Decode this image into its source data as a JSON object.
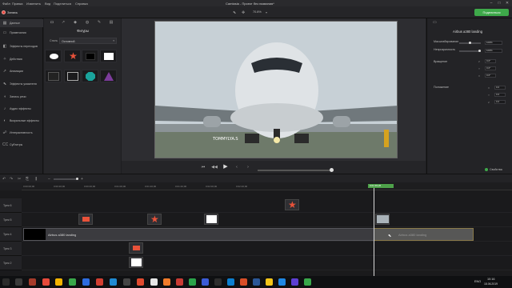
{
  "window": {
    "title": "Camtasia - Проект без названия*"
  },
  "menu": [
    "Файл",
    "Правка",
    "Изменить",
    "Вид",
    "Поделиться",
    "Справка"
  ],
  "toolbar": {
    "record_label": "Запись",
    "share_label": "Поделиться",
    "zoom": "70.8%"
  },
  "tools": [
    {
      "label": "Данные",
      "icon": "media-icon",
      "selected": true
    },
    {
      "label": "Примечания",
      "icon": "annotation-icon"
    },
    {
      "label": "Эффекты переходов",
      "icon": "transition-icon"
    },
    {
      "label": "Действия",
      "icon": "behavior-icon"
    },
    {
      "label": "Анимации",
      "icon": "animation-icon"
    },
    {
      "label": "Эффекты указателя",
      "icon": "cursor-effects-icon"
    },
    {
      "label": "Запись речи",
      "icon": "voice-narration-icon"
    },
    {
      "label": "Аудио эффекты",
      "icon": "audio-effects-icon"
    },
    {
      "label": "Визуальные эффекты",
      "icon": "visual-effects-icon"
    },
    {
      "label": "Интерактивность",
      "icon": "interactivity-icon"
    },
    {
      "label": "Субтитры",
      "icon": "captions-icon"
    }
  ],
  "assets": {
    "title": "Фигуры",
    "style_label": "Стиль",
    "style_value": "Основной",
    "tab_icons": [
      "callout-icon",
      "arrow-icon",
      "shape-icon",
      "blur-icon",
      "sketch-icon",
      "keystroke-icon"
    ],
    "shapes": [
      "ellipse-shape-icon",
      "star-shape-icon",
      "black-rect-shape-icon",
      "white-rect-shape-icon",
      "dark-rect-shape-icon",
      "outline-rect-shape-icon",
      "teal-octagon-shape-icon",
      "purple-triangle-shape-icon"
    ]
  },
  "preview": {
    "caption": "TOMMYLYA.S",
    "colors": {
      "sky": "#c7d0d6",
      "ground": "#6e7a6a",
      "plane": "#dfe3e6"
    }
  },
  "properties": {
    "clip_name": "Airbus a380 landing",
    "scale_label": "Масштабирование",
    "scale_value": "100%",
    "opacity_label": "Непрозрачность",
    "opacity_value": "100%",
    "rotation_label": "Вращение",
    "rotation": [
      {
        "axis": "Z",
        "value": "0.0°"
      },
      {
        "axis": "Y",
        "value": "0.0°"
      },
      {
        "axis": "X",
        "value": "0.0°"
      }
    ],
    "position_label": "Положение",
    "position": [
      {
        "axis": "X",
        "value": "0.0"
      },
      {
        "axis": "Y",
        "value": "0.0"
      },
      {
        "axis": "Z",
        "value": "0.0"
      }
    ],
    "props_button": "Свойства"
  },
  "timeline": {
    "playhead_time": "0:01:39;26",
    "ruler": [
      "0:00:00;00",
      "0:00:20;00",
      "0:00:40;00",
      "0:01:00;00",
      "0:01:20;00",
      "0:01:40;00",
      "0:02:00;00",
      "0:02:20;00"
    ],
    "tracks": [
      "Трек 6",
      "Трек 5",
      "Трек 4",
      "Трек 3",
      "Трек 2"
    ],
    "video_clip_label": "Airbus a380 landing",
    "ghost_clip_label": "Airbus a380 landing"
  },
  "taskbar": {
    "time": "10:16",
    "date": "18.06.2019",
    "lang": "ENG"
  }
}
